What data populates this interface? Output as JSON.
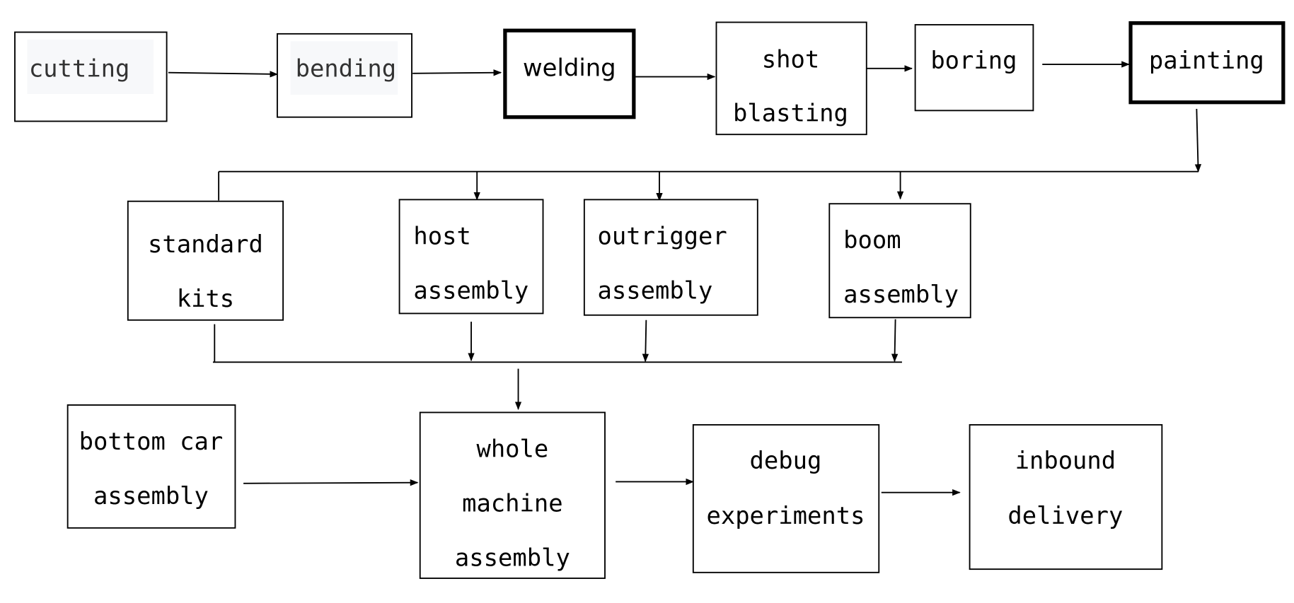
{
  "nodes": {
    "cutting": "cutting",
    "bending": "bending",
    "welding": "welding",
    "shot_blasting": [
      "shot",
      "blasting"
    ],
    "boring": "boring",
    "painting": "painting",
    "standard_kits": [
      "standard",
      "kits"
    ],
    "host_assembly": [
      "host",
      "assembly"
    ],
    "outrigger_assembly": [
      "outrigger",
      "assembly"
    ],
    "boom_assembly": [
      "boom",
      "assembly"
    ],
    "bottom_car_assembly": [
      "bottom car",
      "assembly"
    ],
    "whole_machine_assembly": [
      "whole",
      "machine",
      "assembly"
    ],
    "debug_experiments": [
      "debug",
      "experiments"
    ],
    "inbound_delivery": [
      "inbound",
      "delivery"
    ]
  },
  "colors": {
    "line": "#000000",
    "highlight_bg": "#f7f8fa"
  }
}
